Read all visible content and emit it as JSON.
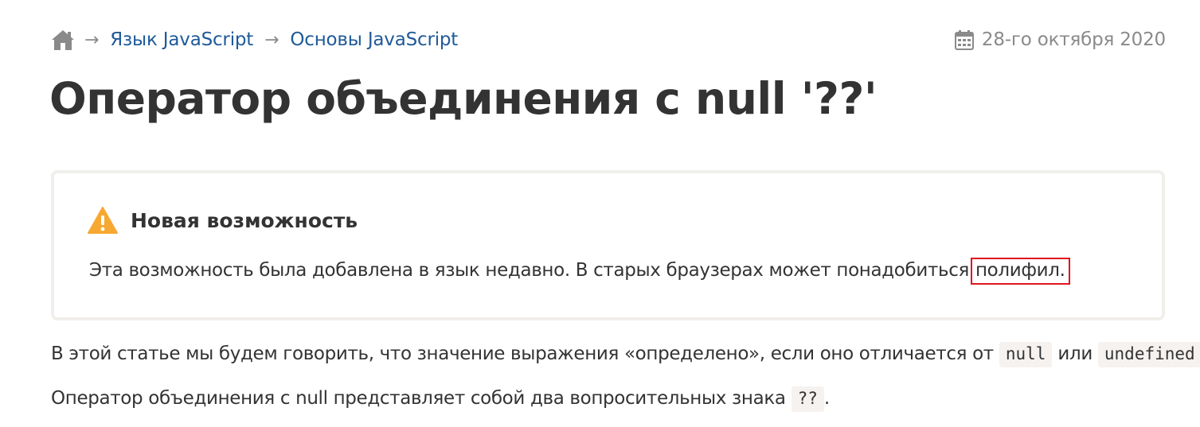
{
  "breadcrumbs": {
    "home_icon": "home-icon",
    "separator": "→",
    "items": [
      {
        "label": "Язык JavaScript"
      },
      {
        "label": "Основы JavaScript"
      }
    ]
  },
  "date": {
    "icon": "calendar-icon",
    "text": "28-го октября 2020"
  },
  "page": {
    "title": "Оператор объединения с null '??'"
  },
  "notice": {
    "icon": "warning-icon",
    "title": "Новая возможность",
    "text": "Эта возможность была добавлена в язык недавно. В старых браузерах может понадобиться",
    "link_label": "полифил.",
    "highlight_color": "#e0141d"
  },
  "content": {
    "para1_before": "В этой статье мы будем говорить, что значение выражения «определено», если оно отличается от",
    "para1_code1": "null",
    "para1_mid": "или",
    "para1_code2": "undefined",
    "para1_end": ".",
    "para2_before": "Оператор объединения с null представляет собой два вопросительных знака",
    "para2_code": "??",
    "para2_end": "."
  },
  "colors": {
    "link": "#1f5a99",
    "muted": "#8a8a8a",
    "warning": "#f7a830",
    "text": "#333333"
  }
}
